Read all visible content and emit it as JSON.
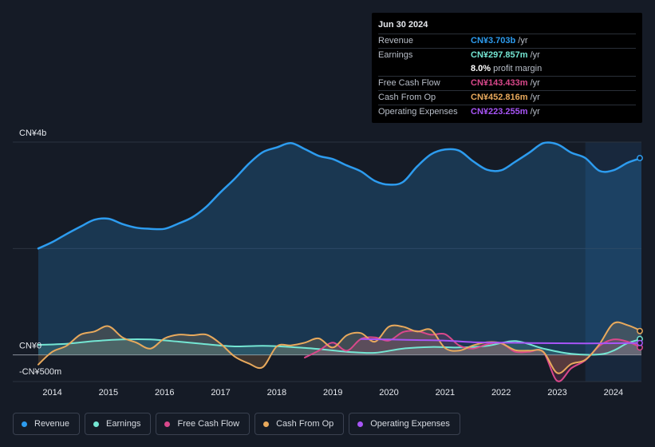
{
  "tooltip": {
    "date": "Jun 30 2024",
    "rows": [
      {
        "label": "Revenue",
        "value": "CN¥3.703b",
        "unit": "/yr",
        "color": "#2d9cef"
      },
      {
        "label": "Earnings",
        "value": "CN¥297.857m",
        "unit": "/yr",
        "color": "#74e6d3"
      },
      {
        "label": "",
        "value": "8.0%",
        "unit": "profit margin",
        "color": "#ffffff"
      },
      {
        "label": "Free Cash Flow",
        "value": "CN¥143.433m",
        "unit": "/yr",
        "color": "#d9488b"
      },
      {
        "label": "Cash From Op",
        "value": "CN¥452.816m",
        "unit": "/yr",
        "color": "#e8a95c"
      },
      {
        "label": "Operating Expenses",
        "value": "CN¥223.255m",
        "unit": "/yr",
        "color": "#a855f7"
      }
    ]
  },
  "legend": [
    {
      "label": "Revenue",
      "color": "#2d9cef"
    },
    {
      "label": "Earnings",
      "color": "#74e6d3"
    },
    {
      "label": "Free Cash Flow",
      "color": "#d9488b"
    },
    {
      "label": "Cash From Op",
      "color": "#e8a95c"
    },
    {
      "label": "Operating Expenses",
      "color": "#a855f7"
    }
  ],
  "chart_data": {
    "type": "area",
    "ytick_labels": [
      {
        "value": 4000,
        "label": "CN¥4b"
      },
      {
        "value": 0,
        "label": "CN¥0"
      },
      {
        "value": -500,
        "label": "-CN¥500m"
      }
    ],
    "ylim": [
      -500,
      4000
    ],
    "xlim": [
      2013.75,
      2024.5
    ],
    "xticks": [
      2014,
      2015,
      2016,
      2017,
      2018,
      2019,
      2020,
      2021,
      2022,
      2023,
      2024
    ],
    "highlight_from": 2023.5,
    "grid": true,
    "series": [
      {
        "name": "Revenue",
        "color": "#2d9cef",
        "area": true,
        "x": [
          2013.75,
          2014.0,
          2014.25,
          2014.5,
          2014.75,
          2015.0,
          2015.25,
          2015.5,
          2015.75,
          2016.0,
          2016.25,
          2016.5,
          2016.75,
          2017.0,
          2017.25,
          2017.5,
          2017.75,
          2018.0,
          2018.25,
          2018.5,
          2018.75,
          2019.0,
          2019.25,
          2019.5,
          2019.75,
          2020.0,
          2020.25,
          2020.5,
          2020.75,
          2021.0,
          2021.25,
          2021.5,
          2021.75,
          2022.0,
          2022.25,
          2022.5,
          2022.75,
          2023.0,
          2023.25,
          2023.5,
          2023.75,
          2024.0,
          2024.25,
          2024.5
        ],
        "y": [
          2000,
          2120,
          2270,
          2410,
          2540,
          2560,
          2460,
          2390,
          2370,
          2370,
          2470,
          2590,
          2790,
          3060,
          3310,
          3590,
          3810,
          3900,
          3980,
          3870,
          3740,
          3680,
          3560,
          3450,
          3270,
          3200,
          3250,
          3540,
          3770,
          3860,
          3840,
          3640,
          3480,
          3470,
          3630,
          3800,
          3980,
          3960,
          3800,
          3700,
          3460,
          3470,
          3610,
          3700
        ]
      },
      {
        "name": "Earnings",
        "color": "#74e6d3",
        "area": true,
        "x": [
          2013.75,
          2014.25,
          2014.75,
          2015.25,
          2015.75,
          2016.25,
          2016.75,
          2017.25,
          2017.75,
          2018.25,
          2018.75,
          2019.25,
          2019.75,
          2020.25,
          2020.75,
          2021.25,
          2021.75,
          2022.25,
          2022.75,
          2023.25,
          2023.75,
          2024.0,
          2024.25,
          2024.5
        ],
        "y": [
          190,
          210,
          260,
          290,
          290,
          250,
          200,
          160,
          170,
          150,
          110,
          60,
          40,
          120,
          150,
          140,
          170,
          260,
          120,
          20,
          10,
          80,
          220,
          300
        ]
      },
      {
        "name": "Free Cash Flow",
        "color": "#d9488b",
        "area": true,
        "x": [
          2018.5,
          2018.75,
          2019.0,
          2019.25,
          2019.5,
          2019.75,
          2020.0,
          2020.25,
          2020.5,
          2020.75,
          2021.0,
          2021.25,
          2021.5,
          2021.75,
          2022.0,
          2022.25,
          2022.5,
          2022.75,
          2023.0,
          2023.25,
          2023.5,
          2023.75,
          2024.0,
          2024.25,
          2024.5
        ],
        "y": [
          -50,
          80,
          230,
          80,
          300,
          330,
          270,
          430,
          450,
          380,
          390,
          180,
          120,
          200,
          220,
          60,
          60,
          60,
          -490,
          -250,
          -100,
          170,
          290,
          250,
          140
        ]
      },
      {
        "name": "Cash From Op",
        "color": "#e8a95c",
        "area": true,
        "x": [
          2013.75,
          2014.0,
          2014.25,
          2014.5,
          2014.75,
          2015.0,
          2015.25,
          2015.5,
          2015.75,
          2016.0,
          2016.25,
          2016.5,
          2016.75,
          2017.0,
          2017.25,
          2017.5,
          2017.75,
          2018.0,
          2018.25,
          2018.5,
          2018.75,
          2019.0,
          2019.25,
          2019.5,
          2019.75,
          2020.0,
          2020.25,
          2020.5,
          2020.75,
          2021.0,
          2021.25,
          2021.5,
          2021.75,
          2022.0,
          2022.25,
          2022.5,
          2022.75,
          2023.0,
          2023.25,
          2023.5,
          2023.75,
          2024.0,
          2024.25,
          2024.5
        ],
        "y": [
          -180,
          60,
          170,
          380,
          440,
          540,
          330,
          230,
          120,
          310,
          380,
          370,
          380,
          210,
          -30,
          -160,
          -230,
          160,
          180,
          230,
          310,
          140,
          370,
          410,
          250,
          530,
          530,
          440,
          470,
          130,
          80,
          180,
          240,
          220,
          90,
          80,
          60,
          -340,
          -170,
          -90,
          200,
          590,
          560,
          450
        ]
      },
      {
        "name": "Operating Expenses",
        "color": "#a855f7",
        "area": false,
        "x": [
          2019.5,
          2020.0,
          2020.5,
          2021.0,
          2021.5,
          2022.0,
          2022.5,
          2023.0,
          2023.5,
          2024.0,
          2024.5
        ],
        "y": [
          300,
          290,
          280,
          270,
          240,
          230,
          225,
          220,
          215,
          220,
          225
        ]
      }
    ]
  }
}
